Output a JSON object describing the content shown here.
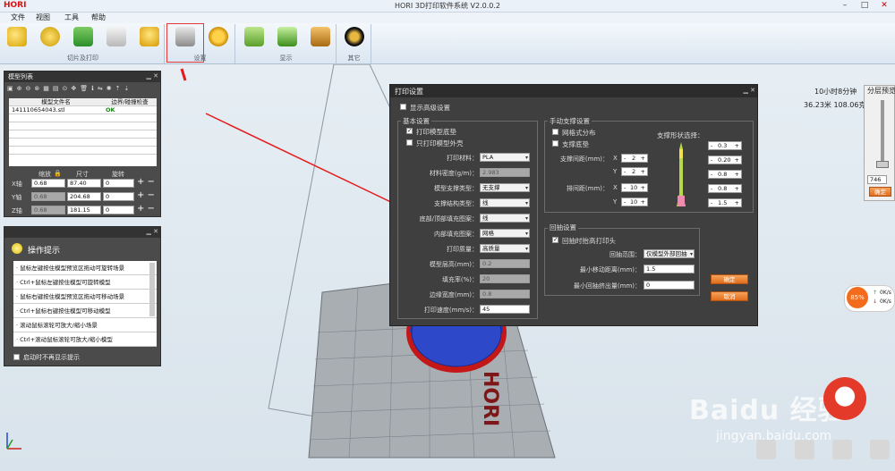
{
  "app": {
    "title": "HORI 3D打印软件系统 V2.0.0.2",
    "logo": "HORI"
  },
  "menu": [
    "文件",
    "视图",
    "工具",
    "帮助"
  ],
  "ribbon": {
    "groups": [
      "切片及打印",
      "设置",
      "显示",
      "其它"
    ]
  },
  "stats": {
    "time": "10小时8分钟",
    "usage": "36.23米 108.06克"
  },
  "preview": {
    "title": "分层预览",
    "value": "746",
    "ok": "确定"
  },
  "model_list": {
    "title": "模型列表",
    "col_file": "模型文件名",
    "col_check": "边界/碰撞检查",
    "file": "141110654043.stl",
    "status": "OK",
    "hdr_scale": "缩放",
    "hdr_size": "尺寸",
    "hdr_rotate": "旋转",
    "axes": [
      {
        "axis": "X轴",
        "scale": "0.68",
        "size": "87.40",
        "rot": "0"
      },
      {
        "axis": "Y轴",
        "scale": "0.68",
        "size": "204.68",
        "rot": "0"
      },
      {
        "axis": "Z轴",
        "scale": "0.68",
        "size": "181.15",
        "rot": "0"
      }
    ]
  },
  "tips": {
    "title": "操作提示",
    "items": [
      "· 鼠标左键按住模型预览区拖动可旋转场景",
      "· Ctrl+鼠标左键按住模型可旋转模型",
      "· 鼠标右键按住模型预览区拖动可移动场景",
      "· Ctrl+鼠标右键按住模型可移动模型",
      "· 滚动鼠标滚轮可放大/缩小场景",
      "· Ctrl+滚动鼠标滚轮可放大/缩小模型"
    ],
    "no_show": "启动时不再显示提示"
  },
  "dialog": {
    "title": "打印设置",
    "show_advanced": "显示高级设置",
    "basic": {
      "legend": "基本设置",
      "raft": "打印模型底垫",
      "shell_only": "只打印模型外壳",
      "rows": [
        {
          "label": "打印材料：",
          "value": "PLA",
          "kind": "sel"
        },
        {
          "label": "材料密度(g/m)：",
          "value": "2.983",
          "kind": "dis"
        },
        {
          "label": "模型支撑类型：",
          "value": "无支撑",
          "kind": "sel"
        },
        {
          "label": "支撑结构类型：",
          "value": "线",
          "kind": "sel"
        },
        {
          "label": "底部/顶部填充图案：",
          "value": "线",
          "kind": "sel"
        },
        {
          "label": "内部填充图案：",
          "value": "网格",
          "kind": "sel"
        },
        {
          "label": "打印质量：",
          "value": "高质量",
          "kind": "sel"
        },
        {
          "label": "模型层高(mm)：",
          "value": "0.2",
          "kind": "dis"
        },
        {
          "label": "填充率(%)：",
          "value": "20",
          "kind": "dis"
        },
        {
          "label": "边缘宽度(mm)：",
          "value": "0.8",
          "kind": "dis"
        },
        {
          "label": "打印速度(mm/s)：",
          "value": "45",
          "kind": "inp"
        }
      ]
    },
    "support": {
      "legend": "手动支撑设置",
      "grid": "网格式分布",
      "base": "支撑底垫",
      "shape_label": "支撑形状选择：",
      "spacing_label": "支撑间距(mm)：",
      "spacing_x": "2",
      "spacing_y": "2",
      "row_label": "排间距(mm)：",
      "row_x": "10",
      "row_y": "10",
      "shape_values": [
        "0.3",
        "0.20",
        "0.8",
        "0.8",
        "1.5"
      ]
    },
    "retract": {
      "legend": "回抽设置",
      "lift": "回抽时抬高打印头",
      "range_label": "回抽范围：",
      "range_value": "仅模型外部回抽",
      "min_dist_label": "最小移动距离(mm)：",
      "min_dist_value": "1.5",
      "min_extrude_label": "最小回抽挤出量(mm)：",
      "min_extrude_value": "0"
    },
    "ok": "确定",
    "cancel": "取消"
  },
  "net": {
    "pct": "85%",
    "up": "0K/s",
    "down": "0K/s"
  },
  "watermark": {
    "text": "Baidu 经验",
    "url": "jingyan.baidu.com"
  }
}
